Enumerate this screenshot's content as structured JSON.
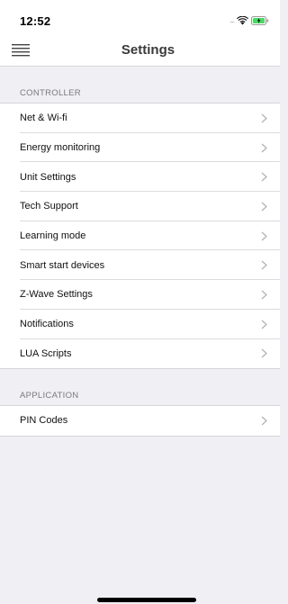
{
  "status_bar": {
    "time": "12:52",
    "signal_text": "....",
    "icons": [
      "wifi-icon",
      "battery-charging-icon"
    ],
    "battery_color": "#4cd964"
  },
  "nav": {
    "title": "Settings",
    "menu_icon": "list-menu-icon"
  },
  "sections": [
    {
      "header": "CONTROLLER",
      "items": [
        {
          "label": "Net & Wi-fi"
        },
        {
          "label": "Energy monitoring"
        },
        {
          "label": "Unit Settings"
        },
        {
          "label": "Tech Support"
        },
        {
          "label": "Learning mode"
        },
        {
          "label": "Smart start devices"
        },
        {
          "label": "Z-Wave Settings"
        },
        {
          "label": "Notifications"
        },
        {
          "label": "LUA Scripts"
        }
      ]
    },
    {
      "header": "APPLICATION",
      "items": [
        {
          "label": "PIN Codes"
        }
      ]
    }
  ],
  "colors": {
    "background": "#efeff4",
    "chevron": "#b0b0b5",
    "separator": "#dcdce0"
  }
}
